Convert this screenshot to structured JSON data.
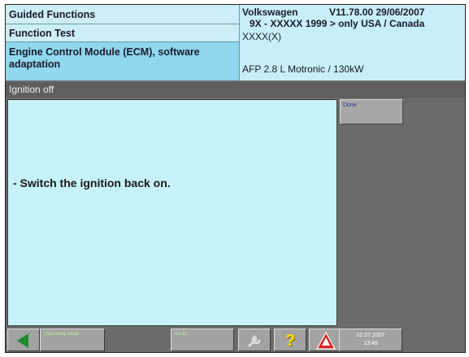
{
  "header": {
    "left": {
      "guided_functions": "Guided Functions",
      "function_test": "Function Test",
      "selected_function": "Engine Control Module (ECM), software adaptation"
    },
    "right": {
      "brand": "Volkswagen",
      "version": "V11.78.00 29/06/2007",
      "model_range": "9X - XXXXX 1999 > only USA / Canada",
      "model_code": "XXXX(X)",
      "engine": "AFP 2.8 L Motronic / 130kW"
    }
  },
  "title_bar": {
    "label": "Ignition off"
  },
  "content": {
    "instruction": "- Switch the ignition back on."
  },
  "side_panel": {
    "done_label": "Done"
  },
  "toolbar": {
    "operating_mode_label": "Operating mode",
    "goto_label": "Go to",
    "date": "02.07.2007",
    "time": "13:49"
  },
  "icons": {
    "back": "back-arrow-icon",
    "tool": "wrench-icon",
    "help": "help-icon",
    "warning": "warning-icon"
  },
  "colors": {
    "header_bg": "#c8eefa",
    "selected_bg": "#8fd8ee",
    "content_bg": "#c8f2fb",
    "frame_gray": "#6b6b6b",
    "back_arrow": "#1a8c2c",
    "help_yellow": "#ffe000",
    "warning_red": "#e02020"
  }
}
